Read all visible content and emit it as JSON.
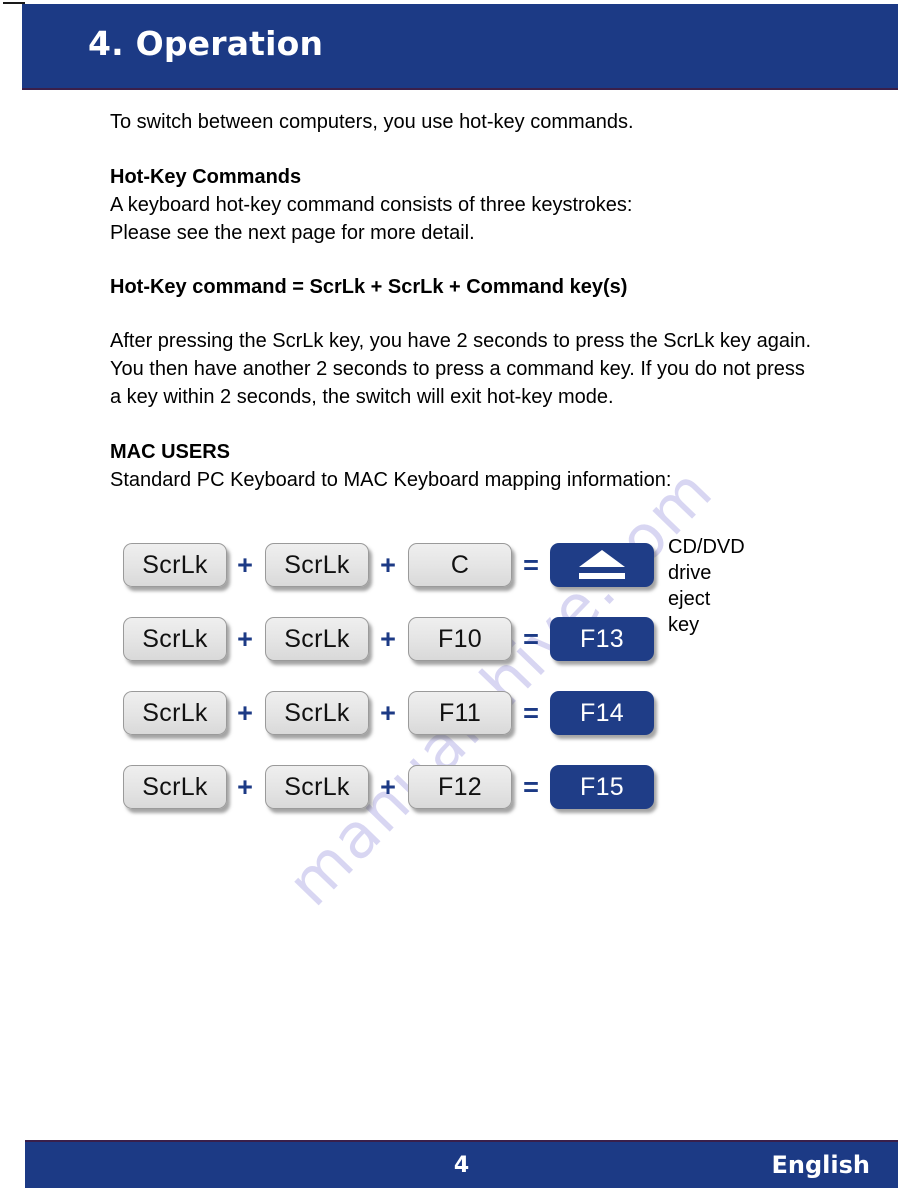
{
  "colors": {
    "brand_navy": "#1c3a85",
    "result_navy": "#1f3d87",
    "key_gray": "#e4e4e4",
    "watermark": "#b9b6e8",
    "text": "#000000"
  },
  "header": {
    "title": "4. Operation"
  },
  "watermark": {
    "text": "manualshive.com"
  },
  "body": {
    "intro": "To switch between computers, you use hot-key commands.",
    "section1_heading": "Hot-Key Commands",
    "section1_lines": "A keyboard hot-key command consists of three keystrokes:\nPlease see the next page for more detail.",
    "formula": "Hot-Key command = ScrLk + ScrLk + Command key(s)",
    "timing_paragraph": "After pressing the ScrLk key, you have 2 seconds to press the ScrLk key again.\nYou then have another 2 seconds to press a command key.  If you do not press\na key within 2 seconds, the switch will exit hot-key mode.",
    "section2_heading": "MAC USERS",
    "section2_line": "Standard PC Keyboard to MAC Keyboard mapping information:"
  },
  "operators": {
    "plus": "+",
    "equals": "="
  },
  "mapping_rows": [
    {
      "key1": "ScrLk",
      "key2": "ScrLk",
      "key3": "C",
      "result_label": "",
      "result_icon": "eject-icon",
      "note": "CD/DVD drive\neject key"
    },
    {
      "key1": "ScrLk",
      "key2": "ScrLk",
      "key3": "F10",
      "result_label": "F13",
      "result_icon": "",
      "note": ""
    },
    {
      "key1": "ScrLk",
      "key2": "ScrLk",
      "key3": "F11",
      "result_label": "F14",
      "result_icon": "",
      "note": ""
    },
    {
      "key1": "ScrLk",
      "key2": "ScrLk",
      "key3": "F12",
      "result_label": "F15",
      "result_icon": "",
      "note": ""
    }
  ],
  "footer": {
    "page_number": "4",
    "language": "English"
  }
}
